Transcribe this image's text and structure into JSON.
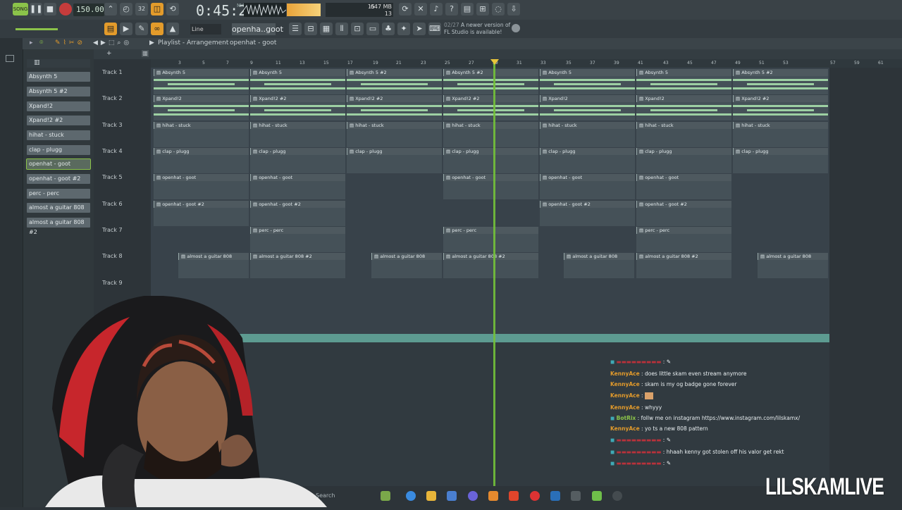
{
  "toolbar": {
    "song_mode": "SONG",
    "tempo": "150.000",
    "time": "0:45:29",
    "time_unit": "M:S:CS",
    "cpu_value": "15",
    "memory": "647 MB",
    "voices": "13",
    "snap": "Line",
    "pattern": "openha..goot",
    "news_date": "02/27",
    "news_text1": "A newer version of",
    "news_text2": "FL Studio is available!"
  },
  "playlist": {
    "title": "Playlist - Arrangement",
    "pattern_name": "openhat - goot",
    "ruler": [
      "3",
      "5",
      "7",
      "9",
      "11",
      "13",
      "15",
      "17",
      "19",
      "21",
      "23",
      "25",
      "27",
      "29",
      "31",
      "33",
      "35",
      "37",
      "39",
      "41",
      "43",
      "45",
      "47",
      "49",
      "51",
      "53",
      "57",
      "59",
      "61"
    ],
    "tracks": [
      "Track 1",
      "Track 2",
      "Track 3",
      "Track 4",
      "Track 5",
      "Track 6",
      "Track 7",
      "Track 8",
      "Track 9"
    ]
  },
  "patterns": [
    "Absynth 5",
    "Absynth 5 #2",
    "Xpand!2",
    "Xpand!2 #2",
    "hihat - stuck",
    "clap - plugg",
    "openhat - goot",
    "openhat - goot #2",
    "perc - perc",
    "almost a guitar 808",
    "almost a guitar 808 #2"
  ],
  "clips": {
    "t1a": "Absynth 5",
    "t1b": "Absynth 5 #2",
    "t2a": "Xpand!2",
    "t2b": "Xpand!2 #2",
    "t3": "hihat - stuck",
    "t4": "clap - plugg",
    "t5": "openhat - goot",
    "t6": "openhat - goot #2",
    "t7": "perc - perc",
    "t8a": "almost a guitar 808",
    "t8b": "almost a guitar 808 #2"
  },
  "chat": [
    {
      "name": "KennyAce",
      "text": "does little skam even stream anymore"
    },
    {
      "name": "KennyAce",
      "text": "skam is my og badge gone forever"
    },
    {
      "name": "KennyAce",
      "text": ""
    },
    {
      "name": "KennyAce",
      "text": "whyyy"
    },
    {
      "name": "BotRix",
      "text": "follw me on instagram https://www.instagram.com/lilskamx/"
    },
    {
      "name": "KennyAce",
      "text": "yo ts a new 808 pattern"
    },
    {
      "name": "",
      "text": "hhaah kenny got stolen off his valor get rekt"
    }
  ],
  "taskbar": {
    "search": "Search"
  },
  "watermark": "LILSKAMLIVE",
  "colors": {
    "accent": "#8bc34a",
    "orange": "#e39b2b",
    "playhead": "#73c13a"
  }
}
